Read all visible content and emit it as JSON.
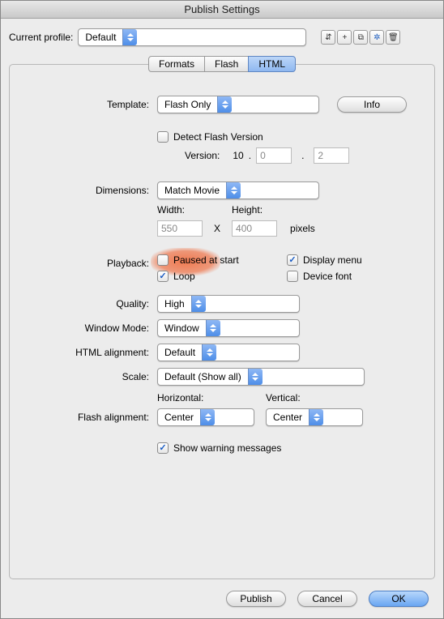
{
  "window": {
    "title": "Publish Settings"
  },
  "profile": {
    "label": "Current profile:",
    "value": "Default",
    "icons": [
      "import-export-icon",
      "plus-icon",
      "duplicate-icon",
      "rename-icon",
      "delete-icon"
    ]
  },
  "tabs": [
    {
      "label": "Formats",
      "active": false
    },
    {
      "label": "Flash",
      "active": false
    },
    {
      "label": "HTML",
      "active": true
    }
  ],
  "template": {
    "label": "Template:",
    "value": "Flash Only",
    "info_label": "Info",
    "detect_label": "Detect Flash Version",
    "detect_checked": false,
    "version_label": "Version:",
    "version_major": "10",
    "version_minor": "0",
    "version_rev": "2"
  },
  "dimensions": {
    "label": "Dimensions:",
    "value": "Match Movie",
    "width_label": "Width:",
    "height_label": "Height:",
    "width": "550",
    "height": "400",
    "pixels_label": "pixels"
  },
  "playback": {
    "label": "Playback:",
    "paused_label": "Paused at start",
    "paused_checked": false,
    "display_menu_label": "Display menu",
    "display_menu_checked": true,
    "loop_label": "Loop",
    "loop_checked": true,
    "device_font_label": "Device font",
    "device_font_checked": false
  },
  "quality": {
    "label": "Quality:",
    "value": "High"
  },
  "window_mode": {
    "label": "Window Mode:",
    "value": "Window"
  },
  "html_alignment": {
    "label": "HTML alignment:",
    "value": "Default"
  },
  "scale": {
    "label": "Scale:",
    "value": "Default (Show all)"
  },
  "flash_alignment": {
    "label": "Flash alignment:",
    "horizontal_label": "Horizontal:",
    "vertical_label": "Vertical:",
    "horizontal": "Center",
    "vertical": "Center"
  },
  "warning": {
    "label": "Show warning messages",
    "checked": true
  },
  "footer": {
    "publish": "Publish",
    "cancel": "Cancel",
    "ok": "OK"
  }
}
